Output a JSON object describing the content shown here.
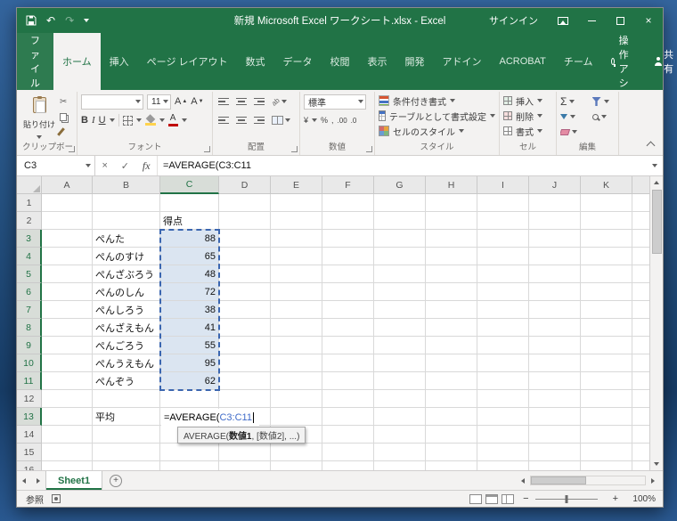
{
  "icons": {
    "undo": "↶",
    "redo": "↷",
    "close": "×",
    "cancel": "×",
    "enter_check": "✓",
    "autosum": "Σ",
    "font_color_letter": "A",
    "grow_font_letter": "A",
    "shrink_font_letter": "A",
    "orientation": "ab",
    "add_sheet": "+",
    "zoom_out": "−",
    "zoom_in": "+",
    "cut": "✂"
  },
  "titlebar": {
    "title": "新規 Microsoft Excel ワークシート.xlsx - Excel",
    "signin": "サインイン"
  },
  "ribbon": {
    "file_tab": "ファイル",
    "tabs": [
      "ホーム",
      "挿入",
      "ページ レイアウト",
      "数式",
      "データ",
      "校閲",
      "表示",
      "開発",
      "アドイン",
      "ACROBAT",
      "チーム"
    ],
    "active_tab": "ホーム",
    "tell_me": "操作アシ",
    "share": "共有",
    "groups": {
      "clipboard": {
        "label": "クリップボード",
        "paste": "貼り付け"
      },
      "font": {
        "label": "フォント",
        "font_name": "",
        "font_size": "11",
        "bold": "B",
        "italic": "I",
        "underline": "U"
      },
      "alignment": {
        "label": "配置"
      },
      "number": {
        "label": "数値",
        "format": "標準",
        "currency": "¥",
        "percent": "%",
        "comma": ",",
        "add_decimal": ".00",
        "remove_decimal": ".0"
      },
      "styles": {
        "label": "スタイル",
        "items": [
          "条件付き書式",
          "テーブルとして書式設定",
          "セルのスタイル"
        ]
      },
      "cells": {
        "label": "セル",
        "items": [
          "挿入",
          "削除",
          "書式"
        ]
      },
      "editing": {
        "label": "編集"
      }
    }
  },
  "formula_bar": {
    "name_box": "C3",
    "fx_label": "fx",
    "formula": "=AVERAGE(C3:C11"
  },
  "grid": {
    "columns": [
      "A",
      "B",
      "C",
      "D",
      "E",
      "F",
      "G",
      "H",
      "I",
      "J",
      "K"
    ],
    "row_count": 18,
    "highlight_columns": [
      "C"
    ],
    "highlight_rows": [
      3,
      4,
      5,
      6,
      7,
      8,
      9,
      10,
      11,
      13
    ],
    "selection_range": "C3:C11",
    "cells": {
      "C2": "得点",
      "B3": "ぺんた",
      "C3": "88",
      "B4": "ぺんのすけ",
      "C4": "65",
      "B5": "ぺんざぶろう",
      "C5": "48",
      "B6": "ぺんのしん",
      "C6": "72",
      "B7": "ぺんしろう",
      "C7": "38",
      "B8": "ぺんざえもん",
      "C8": "41",
      "B9": "ぺんごろう",
      "C9": "55",
      "B10": "ぺんうえもん",
      "C10": "95",
      "B11": "ぺんぞう",
      "C11": "62",
      "B13": "平均"
    },
    "editing_cell": {
      "ref": "C13",
      "formula_prefix": "=AVERAGE(",
      "formula_range": "C3:C11"
    },
    "function_tooltip": {
      "name": "AVERAGE(",
      "active_arg": "数値1",
      "rest": ", [数値2], ...)"
    }
  },
  "sheet_bar": {
    "active_tab": "Sheet1"
  },
  "status_bar": {
    "mode": "参照",
    "zoom": "100%"
  }
}
